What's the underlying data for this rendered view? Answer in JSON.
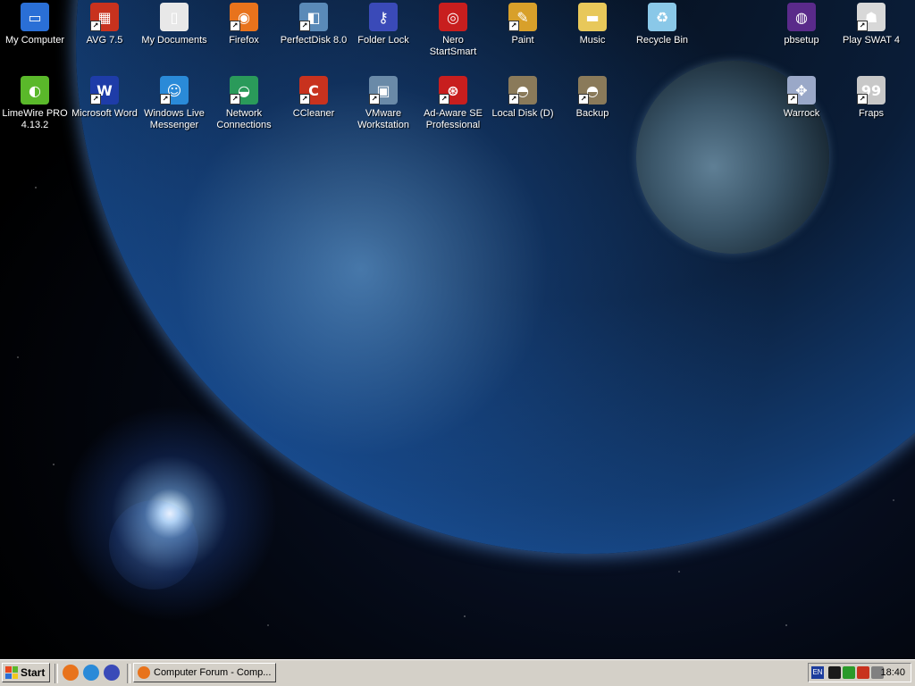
{
  "desktop": {
    "icons": [
      {
        "label": "My Computer",
        "icon": "my-computer-icon",
        "color": "#2a6fd6",
        "glyph": "▭"
      },
      {
        "label": "AVG 7.5",
        "icon": "avg-icon",
        "color": "#c8321e",
        "glyph": "▦"
      },
      {
        "label": "My Documents",
        "icon": "my-documents-icon",
        "color": "#e8e8e8",
        "glyph": "▯"
      },
      {
        "label": "Firefox",
        "icon": "firefox-icon",
        "color": "#e8731c",
        "glyph": "◉"
      },
      {
        "label": "PerfectDisk 8.0",
        "icon": "perfectdisk-icon",
        "color": "#5a8ab8",
        "glyph": "◧"
      },
      {
        "label": "Folder Lock",
        "icon": "folder-lock-icon",
        "color": "#3a4ab8",
        "glyph": "⚷"
      },
      {
        "label": "Nero StartSmart",
        "icon": "nero-icon",
        "color": "#c81e1e",
        "glyph": "◎"
      },
      {
        "label": "Paint",
        "icon": "paint-icon",
        "color": "#d8a02a",
        "glyph": "✎"
      },
      {
        "label": "Music",
        "icon": "music-folder-icon",
        "color": "#e8c85a",
        "glyph": "▬"
      },
      {
        "label": "Recycle Bin",
        "icon": "recycle-bin-icon",
        "color": "#8ac8e8",
        "glyph": "♻"
      },
      {
        "label": "pbsetup",
        "icon": "pbsetup-icon",
        "color": "#5a2a8a",
        "glyph": "◍"
      },
      {
        "label": "Play SWAT 4",
        "icon": "swat4-icon",
        "color": "#d8d8d8",
        "glyph": "☗"
      },
      {
        "label": "LimeWire PRO 4.13.2",
        "icon": "limewire-icon",
        "color": "#5ab82a",
        "glyph": "◐"
      },
      {
        "label": "Microsoft Word",
        "icon": "word-icon",
        "color": "#1e3ca8",
        "glyph": "W"
      },
      {
        "label": "Windows Live Messenger",
        "icon": "messenger-icon",
        "color": "#2a8ad8",
        "glyph": "☺"
      },
      {
        "label": "Network Connections",
        "icon": "network-icon",
        "color": "#2a9a5a",
        "glyph": "◒"
      },
      {
        "label": "CCleaner",
        "icon": "ccleaner-icon",
        "color": "#c8321e",
        "glyph": "C"
      },
      {
        "label": "VMware Workstation",
        "icon": "vmware-icon",
        "color": "#6a8aa8",
        "glyph": "▣"
      },
      {
        "label": "Ad-Aware SE Professional",
        "icon": "ad-aware-icon",
        "color": "#c81e1e",
        "glyph": "⊛"
      },
      {
        "label": "Local Disk (D)",
        "icon": "local-disk-icon",
        "color": "#8a7a5a",
        "glyph": "◓"
      },
      {
        "label": "Backup",
        "icon": "backup-icon",
        "color": "#8a7a5a",
        "glyph": "◓"
      },
      {
        "label": "Warrock",
        "icon": "warrock-icon",
        "color": "#9aa8c8",
        "glyph": "✥"
      },
      {
        "label": "Fraps",
        "icon": "fraps-icon",
        "color": "#c8c8c8",
        "glyph": "99"
      }
    ]
  },
  "taskbar": {
    "start_label": "Start",
    "quick_launch": [
      {
        "icon": "firefox-quicklaunch-icon",
        "color": "#e8731c"
      },
      {
        "icon": "browser-quicklaunch-icon",
        "color": "#2a8ad8"
      },
      {
        "icon": "folder-lock-quicklaunch-icon",
        "color": "#3a4ab8"
      }
    ],
    "task_button_label": "Computer Forum - Comp...",
    "tray": {
      "language": "EN",
      "clock": "18:40",
      "icons": [
        {
          "icon": "fraps-tray-icon",
          "color": "#1a1a1a"
        },
        {
          "icon": "network-tray-icon",
          "color": "#2a9a2a"
        },
        {
          "icon": "avg-tray-icon",
          "color": "#c8321e"
        },
        {
          "icon": "volume-tray-icon",
          "color": "#808080"
        }
      ]
    }
  }
}
